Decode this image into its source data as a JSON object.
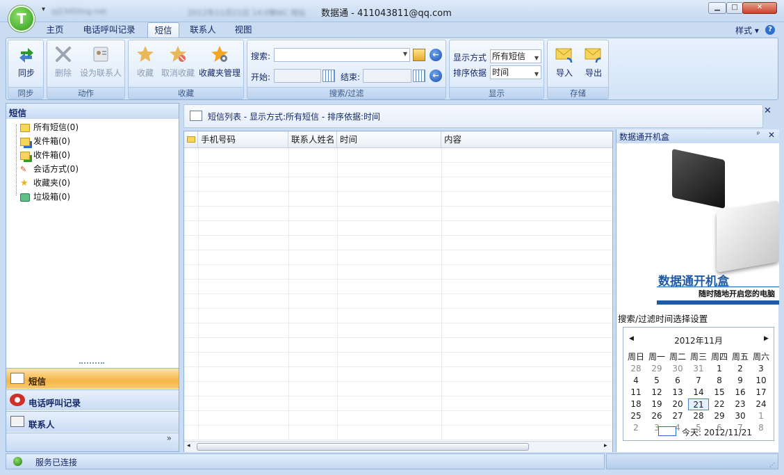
{
  "window": {
    "app_logo_letter": "T",
    "quick_access_blurred": [
      "oj2345ling.net",
      "2012年11月21日 14:05",
      "MAC 地址"
    ],
    "title": "数据通 - 411043811@qq.com",
    "min_glyph": "▁",
    "max_glyph": "□",
    "close_glyph": "✕"
  },
  "tabs": [
    "主页",
    "电话呼叫记录",
    "短信",
    "联系人",
    "视图"
  ],
  "active_tab": "短信",
  "style_menu": "样式",
  "ribbon": {
    "sync": {
      "label": "同步",
      "group": "同步"
    },
    "action": {
      "delete": "删除",
      "set_contact": "设为联系人",
      "group": "动作"
    },
    "favorites": {
      "add": "收藏",
      "remove": "取消收藏",
      "manage": "收藏夹管理",
      "group": "收藏"
    },
    "search": {
      "search_label": "搜索:",
      "start_label": "开始:",
      "end_label": "结束:",
      "group": "搜索/过滤"
    },
    "display": {
      "mode_label": "显示方式",
      "mode_value": "所有短信",
      "sort_label": "排序依据",
      "sort_value": "时间",
      "group": "显示"
    },
    "storage": {
      "import": "导入",
      "export": "导出",
      "group": "存储"
    }
  },
  "left_panel": {
    "title": "短信",
    "tree": [
      "所有短信(0)",
      "发件箱(0)",
      "收件箱(0)",
      "会话方式(0)",
      "收藏夹(0)",
      "垃圾箱(0)"
    ],
    "nav": [
      "短信",
      "电话呼叫记录",
      "联系人"
    ],
    "more": "»"
  },
  "info_bar": "短信列表 - 显示方式:所有短信 - 排序依据:时间",
  "grid": {
    "columns": [
      "手机号码",
      "联系人姓名",
      "时间",
      "内容"
    ]
  },
  "right_panel": {
    "title": "数据通开机盒",
    "pin": "ᵖ",
    "close": "✕",
    "promo_title": "数据通开机盒",
    "promo_sub": "随时随地开启您的电脑",
    "filter_title": "搜索/过滤时间选择设置",
    "calendar": {
      "month": "2012年11月",
      "weekdays": [
        "周日",
        "周一",
        "周二",
        "周三",
        "周四",
        "周五",
        "周六"
      ],
      "weeks": [
        [
          "28",
          "29",
          "30",
          "31",
          "1",
          "2",
          "3"
        ],
        [
          "4",
          "5",
          "6",
          "7",
          "8",
          "9",
          "10"
        ],
        [
          "11",
          "12",
          "13",
          "14",
          "15",
          "16",
          "17"
        ],
        [
          "18",
          "19",
          "20",
          "21",
          "22",
          "23",
          "24"
        ],
        [
          "25",
          "26",
          "27",
          "28",
          "29",
          "30",
          "1"
        ],
        [
          "2",
          "3",
          "4",
          "5",
          "6",
          "7",
          "8"
        ]
      ],
      "today_label": "今天: 2012/11/21"
    }
  },
  "status": "服务已连接"
}
